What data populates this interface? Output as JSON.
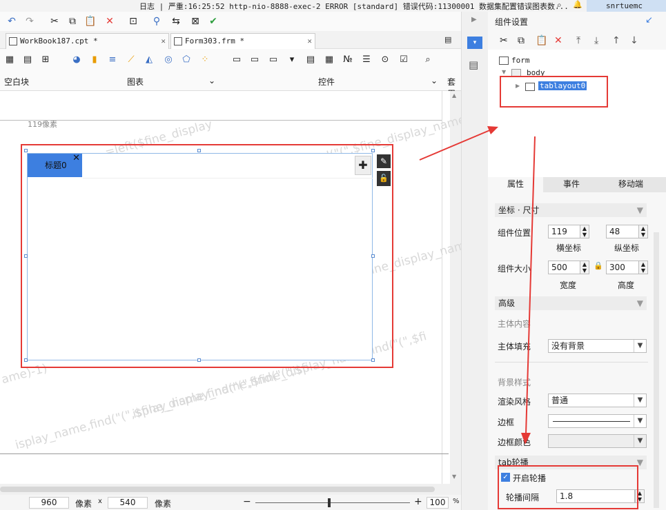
{
  "status_bar": {
    "message": "日志 | 严重:16:25:52 http-nio-8888-exec-2 ERROR [standard] 错误代码:11300001 数据集配置错误图表数...",
    "user": "snrtuemc"
  },
  "doc_tabs": [
    {
      "label": "WorkBook187.cpt *"
    },
    {
      "label": "Form303.frm *"
    }
  ],
  "ribbon": {
    "blank_block": "空白块",
    "charts": "图表",
    "controls": "控件",
    "more": "套用"
  },
  "canvas": {
    "ruler_label": "119像素",
    "watermark": "=left($fine_display_name,find(\"(\",$fine_display_name)-1)",
    "watermark_part": "=left($fine_display",
    "watermark_part2": "ame)-1)",
    "watermark_part3": "isplay_name,find(\"(\",$fine_display_name,find(\"(\",$fi",
    "tab_title": "标题0"
  },
  "bottom_bar": {
    "width": "960",
    "unit1": "像素",
    "x": "x",
    "height": "540",
    "unit2": "像素",
    "zoom": "100",
    "percent": "%"
  },
  "panel": {
    "title": "组件设置",
    "tree": {
      "root": "form",
      "body": "body",
      "layout": "tablayout0"
    },
    "prop_tabs": [
      "属性",
      "事件",
      "移动端"
    ],
    "coord_section": "坐标 · 尺寸",
    "position_label": "组件位置",
    "x_value": "119",
    "y_value": "48",
    "x_caption": "横坐标",
    "y_caption": "纵坐标",
    "size_label": "组件大小",
    "width_value": "500",
    "height_value": "300",
    "width_caption": "宽度",
    "height_caption": "高度",
    "advanced_section": "高级",
    "main_content": "主体内容",
    "main_fill_label": "主体填充",
    "main_fill_value": "没有背景",
    "bg_style": "背景样式",
    "render_label": "渲染风格",
    "render_value": "普通",
    "border_label": "边框",
    "border_color_label": "边框颜色",
    "carousel_section": "tab轮播",
    "enable_carousel": "开启轮播",
    "interval_label": "轮播间隔",
    "interval_value": "1.8"
  },
  "colors": {
    "accent": "#3d7fe0",
    "highlight": "#e53935"
  }
}
